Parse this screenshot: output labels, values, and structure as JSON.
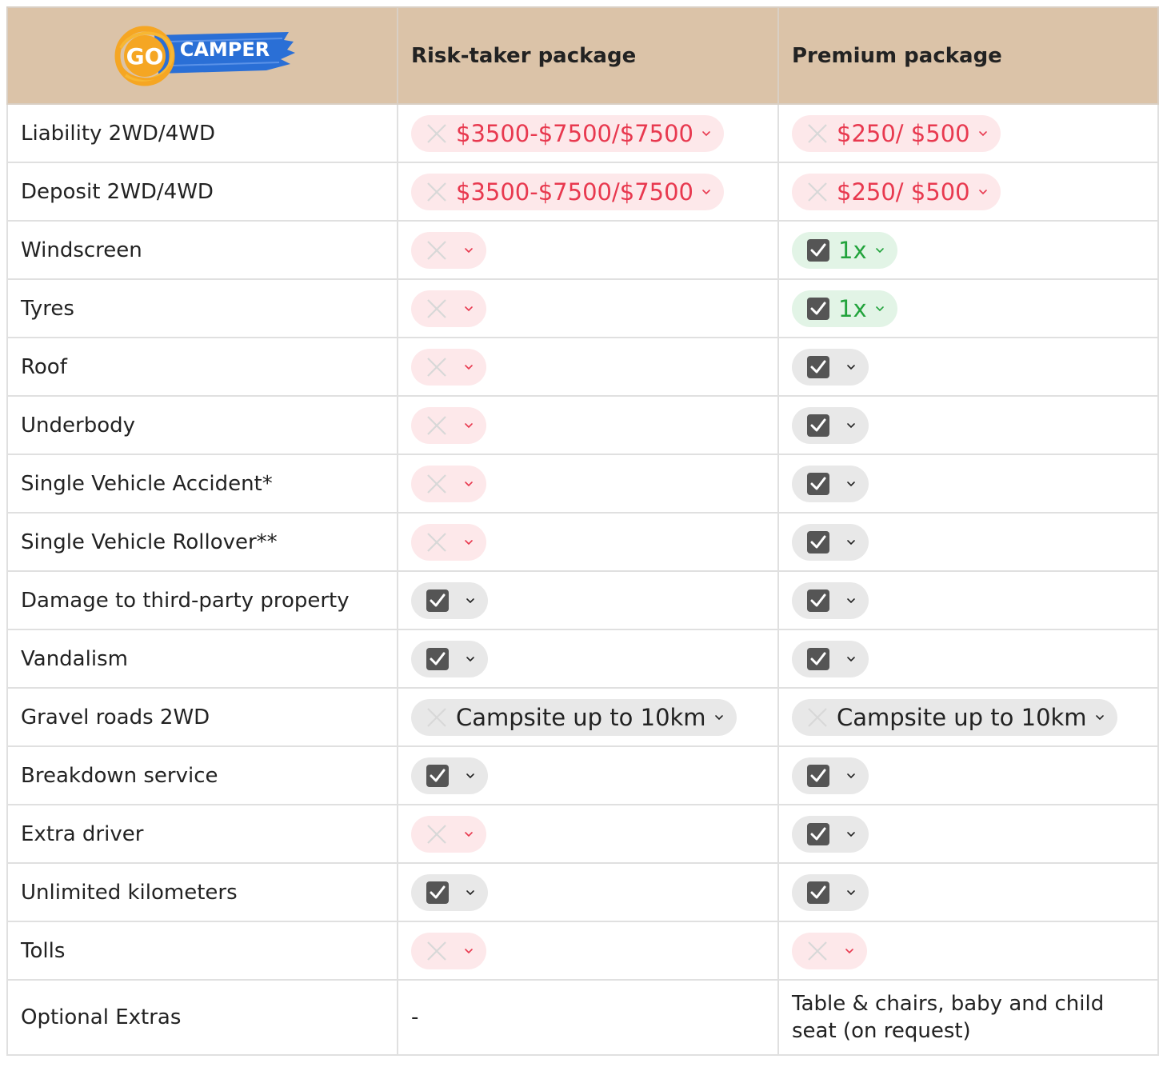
{
  "brand": {
    "logo_go": "GO",
    "logo_camper": "CAMPER"
  },
  "columns": [
    "Risk-taker package",
    "Premium package"
  ],
  "rows": [
    {
      "label": "Liability 2WD/4WD",
      "cells": [
        {
          "status": "no",
          "value": "$3500-$7500/$7500"
        },
        {
          "status": "no",
          "value": "$250/ $500"
        }
      ]
    },
    {
      "label": "Deposit 2WD/4WD",
      "cells": [
        {
          "status": "no",
          "value": "$3500-$7500/$7500"
        },
        {
          "status": "no",
          "value": "$250/ $500"
        }
      ]
    },
    {
      "label": "Windscreen",
      "cells": [
        {
          "status": "no",
          "value": ""
        },
        {
          "status": "yes-green",
          "value": "1x"
        }
      ]
    },
    {
      "label": "Tyres",
      "cells": [
        {
          "status": "no",
          "value": ""
        },
        {
          "status": "yes-green",
          "value": "1x"
        }
      ]
    },
    {
      "label": "Roof",
      "cells": [
        {
          "status": "no",
          "value": ""
        },
        {
          "status": "yes",
          "value": ""
        }
      ]
    },
    {
      "label": "Underbody",
      "cells": [
        {
          "status": "no",
          "value": ""
        },
        {
          "status": "yes",
          "value": ""
        }
      ]
    },
    {
      "label": "Single Vehicle Accident*",
      "cells": [
        {
          "status": "no",
          "value": ""
        },
        {
          "status": "yes",
          "value": ""
        }
      ]
    },
    {
      "label": "Single Vehicle Rollover**",
      "cells": [
        {
          "status": "no",
          "value": ""
        },
        {
          "status": "yes",
          "value": ""
        }
      ]
    },
    {
      "label": "Damage to third-party property",
      "cells": [
        {
          "status": "yes",
          "value": ""
        },
        {
          "status": "yes",
          "value": ""
        }
      ]
    },
    {
      "label": "Vandalism",
      "cells": [
        {
          "status": "yes",
          "value": ""
        },
        {
          "status": "yes",
          "value": ""
        }
      ]
    },
    {
      "label": "Gravel roads 2WD",
      "cells": [
        {
          "status": "neutral",
          "value": "Campsite up to 10km"
        },
        {
          "status": "neutral",
          "value": "Campsite up to 10km"
        }
      ]
    },
    {
      "label": "Breakdown service",
      "cells": [
        {
          "status": "yes",
          "value": ""
        },
        {
          "status": "yes",
          "value": ""
        }
      ]
    },
    {
      "label": "Extra driver",
      "cells": [
        {
          "status": "no",
          "value": ""
        },
        {
          "status": "yes",
          "value": ""
        }
      ]
    },
    {
      "label": "Unlimited kilometers",
      "cells": [
        {
          "status": "yes",
          "value": ""
        },
        {
          "status": "yes",
          "value": ""
        }
      ]
    },
    {
      "label": "Tolls",
      "cells": [
        {
          "status": "no",
          "value": ""
        },
        {
          "status": "no",
          "value": ""
        }
      ]
    }
  ],
  "optional_extras": {
    "label": "Optional Extras",
    "risk_taker": "-",
    "premium": "Table & chairs, baby and child seat (on request)"
  },
  "colors": {
    "header_bg": "#dbc3a8",
    "negative": "#e8394f",
    "negative_bg": "#fde8ea",
    "positive": "#22a33c",
    "positive_bg": "#e2f4e6",
    "neutral_bg": "#e8e8e8",
    "logo_blue": "#2a6fd6",
    "logo_orange": "#f5a623"
  }
}
